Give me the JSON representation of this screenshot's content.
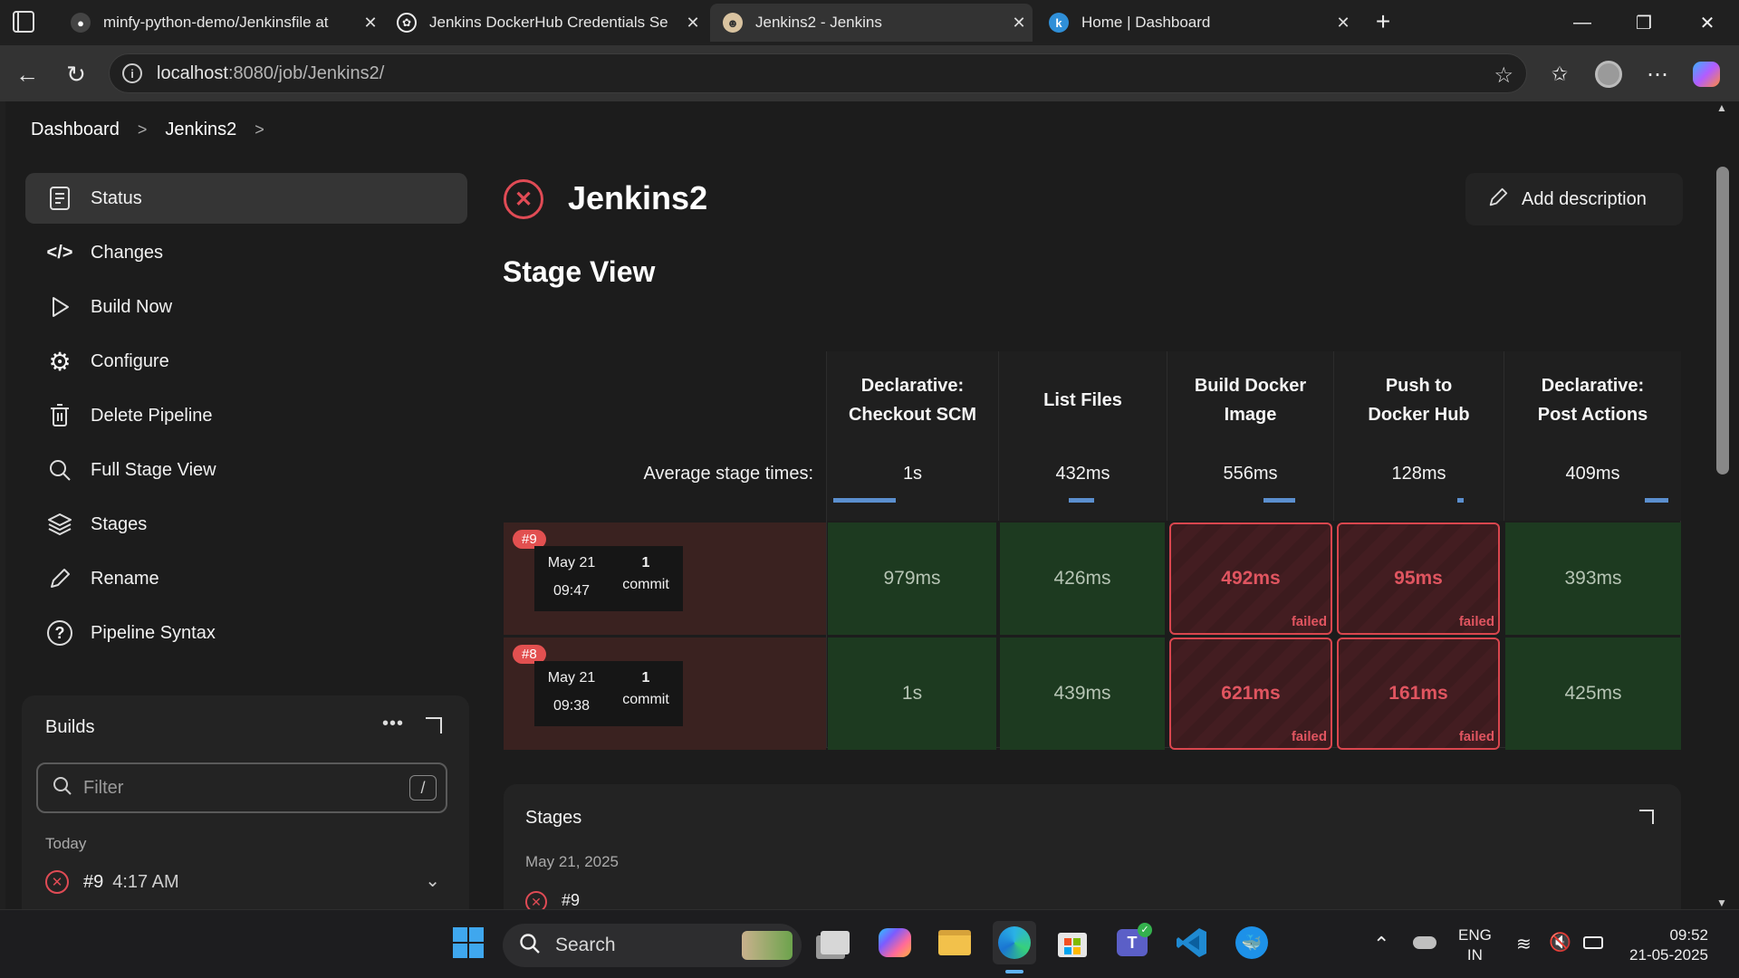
{
  "browser": {
    "tabs": [
      {
        "title": "minfy-python-demo/Jenkinsfile at",
        "icon": "github-icon"
      },
      {
        "title": "Jenkins DockerHub Credentials Se",
        "icon": "openai-icon"
      },
      {
        "title": "Jenkins2 - Jenkins",
        "icon": "jenkins-icon",
        "active": true
      },
      {
        "title": "Home | Dashboard",
        "icon": "k-icon"
      }
    ],
    "url_host": "localhost",
    "url_path": ":8080/job/Jenkins2/"
  },
  "breadcrumb": [
    "Dashboard",
    "Jenkins2"
  ],
  "sidebar": {
    "items": [
      {
        "label": "Status",
        "icon": "status-icon"
      },
      {
        "label": "Changes",
        "icon": "code-icon"
      },
      {
        "label": "Build Now",
        "icon": "play-icon"
      },
      {
        "label": "Configure",
        "icon": "gear-icon"
      },
      {
        "label": "Delete Pipeline",
        "icon": "trash-icon"
      },
      {
        "label": "Full Stage View",
        "icon": "search-icon"
      },
      {
        "label": "Stages",
        "icon": "layers-icon"
      },
      {
        "label": "Rename",
        "icon": "pencil-icon"
      },
      {
        "label": "Pipeline Syntax",
        "icon": "help-icon"
      }
    ]
  },
  "builds": {
    "title": "Builds",
    "filter_placeholder": "Filter",
    "shortcut": "/",
    "group_label": "Today",
    "items": [
      {
        "number": "#9",
        "time": "4:17 AM"
      }
    ]
  },
  "job": {
    "title": "Jenkins2",
    "add_description": "Add description"
  },
  "stage_view": {
    "title": "Stage View",
    "avg_label": "Average stage times:",
    "stages": [
      {
        "line1": "Declarative:",
        "line2": "Checkout SCM",
        "avg": "1s",
        "avg_frac": 0.37
      },
      {
        "line1": "",
        "line2": "List Files",
        "avg": "432ms",
        "avg_frac": 0.15
      },
      {
        "line1": "Build Docker",
        "line2": "Image",
        "avg": "556ms",
        "avg_frac": 0.19
      },
      {
        "line1": "Push to",
        "line2": "Docker Hub",
        "avg": "128ms",
        "avg_frac": 0.04
      },
      {
        "line1": "Declarative:",
        "line2": "Post Actions",
        "avg": "409ms",
        "avg_frac": 0.14
      }
    ],
    "runs": [
      {
        "badge": "#9",
        "date": "May 21",
        "time": "09:47",
        "commits": "1",
        "commit_label": "commit",
        "cells": [
          {
            "value": "979ms",
            "status": "ok"
          },
          {
            "value": "426ms",
            "status": "ok"
          },
          {
            "value": "492ms",
            "status": "failed"
          },
          {
            "value": "95ms",
            "status": "failed"
          },
          {
            "value": "393ms",
            "status": "ok"
          }
        ]
      },
      {
        "badge": "#8",
        "date": "May 21",
        "time": "09:38",
        "commits": "1",
        "commit_label": "commit",
        "cells": [
          {
            "value": "1s",
            "status": "ok"
          },
          {
            "value": "439ms",
            "status": "ok"
          },
          {
            "value": "621ms",
            "status": "failed"
          },
          {
            "value": "161ms",
            "status": "failed"
          },
          {
            "value": "425ms",
            "status": "ok"
          }
        ]
      }
    ],
    "failed_label": "failed"
  },
  "stages_panel": {
    "title": "Stages",
    "date": "May 21, 2025",
    "first_run": "#9"
  },
  "taskbar": {
    "search": "Search",
    "lang1": "ENG",
    "lang2": "IN",
    "time": "09:52",
    "date": "21-05-2025"
  }
}
